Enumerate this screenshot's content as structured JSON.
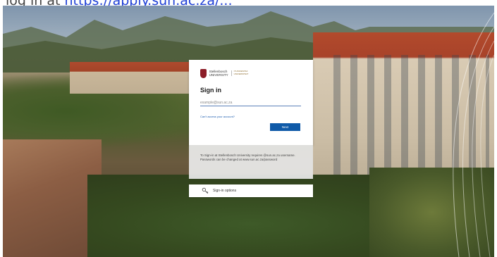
{
  "caption": {
    "text": "log in at ",
    "link": "https://apply.sun.ac.za/..."
  },
  "brand": {
    "name_line1": "Stellenbosch",
    "name_line2": "UNIVERSITY",
    "sub_line1": "IYUNIVESITHI",
    "sub_line2": "UNIVERSITEIT"
  },
  "signin": {
    "title": "Sign in",
    "email_placeholder": "example@sun.ac.za",
    "cant_access": "Can't access your account?",
    "next_label": "Next"
  },
  "info": {
    "text": "To Sign-in at Stellenbosch University requires @sun.ac.za username. Passwords can be changed at www.sun.ac.za/password"
  },
  "options": {
    "label": "Sign-in options",
    "icon": "key-icon"
  },
  "colors": {
    "accent": "#0f5aa8",
    "link": "#1f5fb0",
    "brand": "#8c1d28"
  }
}
